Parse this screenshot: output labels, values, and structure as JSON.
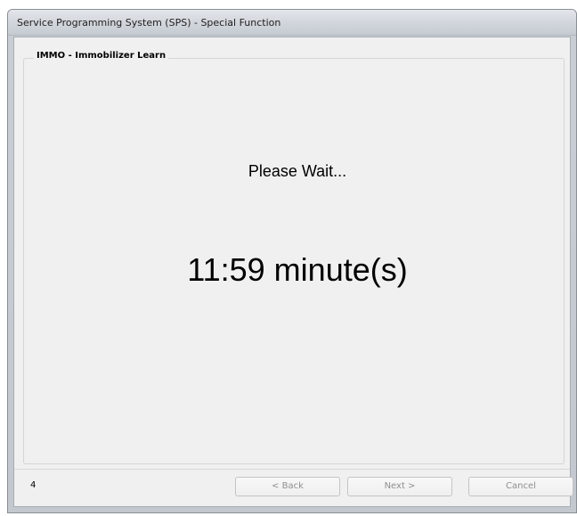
{
  "window": {
    "title": "Service Programming System (SPS) - Special Function"
  },
  "group": {
    "label": "IMMO - Immobilizer Learn"
  },
  "content": {
    "wait_message": "Please Wait...",
    "timer": "11:59 minute(s)"
  },
  "footer": {
    "step": "4",
    "back_label": "< Back",
    "next_label": "Next >",
    "cancel_label": "Cancel"
  }
}
